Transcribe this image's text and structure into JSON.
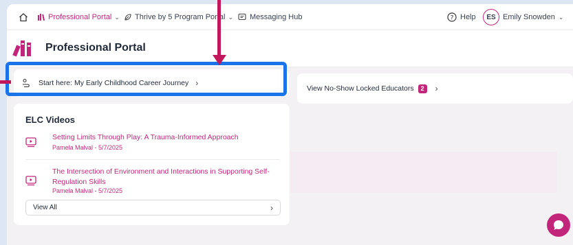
{
  "nav": {
    "portal_label": "Professional Portal",
    "thrive_label": "Thrive by 5 Program Portal",
    "messaging_label": "Messaging Hub",
    "help_label": "Help",
    "user_initials": "ES",
    "user_name": "Emily Snowden"
  },
  "header": {
    "title": "Professional Portal"
  },
  "journey": {
    "label": "Start here: My Early Childhood Career Journey"
  },
  "locked": {
    "label": "View No-Show Locked Educators",
    "count": "2"
  },
  "videos": {
    "title": "ELC Videos",
    "items": [
      {
        "title": "Setting Limits Through Play: A Trauma-Informed Approach",
        "meta": "Pamela Malval - 5/7/2025"
      },
      {
        "title": "The Intersection of Environment and Interactions in Supporting Self-Regulation Skills",
        "meta": "Pamela Malval - 5/7/2025"
      }
    ],
    "view_all_label": "View All"
  },
  "colors": {
    "accent": "#c2267a",
    "highlight": "#1a73e8",
    "arrow": "#c2185b"
  }
}
